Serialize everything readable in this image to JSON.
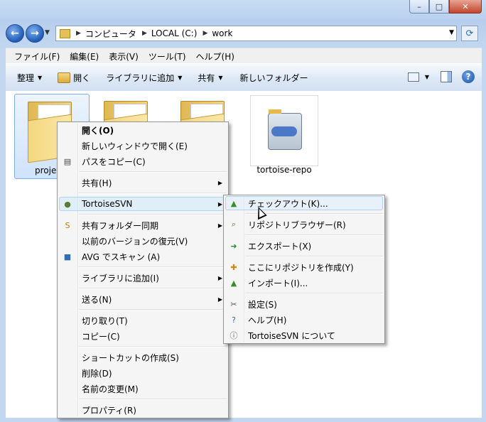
{
  "window": {
    "caption": {
      "min": "–",
      "max": "□",
      "close": "✕"
    }
  },
  "nav": {
    "back": "←",
    "forward": "→",
    "breadcrumb": [
      "コンピュータ",
      "LOCAL (C:)",
      "work"
    ]
  },
  "menubar": [
    "ファイル(F)",
    "編集(E)",
    "表示(V)",
    "ツール(T)",
    "ヘルプ(H)"
  ],
  "toolbar": {
    "organize": "整理",
    "open": "開く",
    "add_library": "ライブラリに追加",
    "share": "共有",
    "new_folder": "新しいフォルダー",
    "help": "?"
  },
  "files": [
    {
      "name": "proje"
    },
    {
      "name": ""
    },
    {
      "name": ""
    },
    {
      "name": "tortoise-repo"
    }
  ],
  "context_menu": [
    {
      "label": "開く(O)",
      "bold": true
    },
    {
      "label": "新しいウィンドウで開く(E)"
    },
    {
      "label": "パスをコピー(C)",
      "icon": "copy-path-icon"
    },
    {
      "sep": true
    },
    {
      "label": "共有(H)",
      "sub": true
    },
    {
      "sep": true
    },
    {
      "label": "TortoiseSVN",
      "sub": true,
      "icon": "tortoise-icon",
      "hl": true
    },
    {
      "sep": true
    },
    {
      "label": "共有フォルダー同期",
      "sub": true,
      "icon": "sync-icon"
    },
    {
      "label": "以前のバージョンの復元(V)"
    },
    {
      "label": "AVG でスキャン (A)",
      "icon": "avg-icon"
    },
    {
      "sep": true
    },
    {
      "label": "ライブラリに追加(I)",
      "sub": true
    },
    {
      "sep": true
    },
    {
      "label": "送る(N)",
      "sub": true
    },
    {
      "sep": true
    },
    {
      "label": "切り取り(T)"
    },
    {
      "label": "コピー(C)"
    },
    {
      "sep": true
    },
    {
      "label": "ショートカットの作成(S)"
    },
    {
      "label": "削除(D)"
    },
    {
      "label": "名前の変更(M)"
    },
    {
      "sep": true
    },
    {
      "label": "プロパティ(R)"
    }
  ],
  "svn_menu": [
    {
      "label": "チェックアウト(K)...",
      "icon": "checkout-icon",
      "hl": true
    },
    {
      "sep": true
    },
    {
      "label": "リポジトリブラウザー(R)",
      "icon": "repo-browser-icon"
    },
    {
      "sep": true
    },
    {
      "label": "エクスポート(X)",
      "icon": "export-icon"
    },
    {
      "sep": true
    },
    {
      "label": "ここにリポジトリを作成(Y)",
      "icon": "create-repo-icon"
    },
    {
      "label": "インポート(I)...",
      "icon": "import-icon"
    },
    {
      "sep": true
    },
    {
      "label": "設定(S)",
      "icon": "settings-icon"
    },
    {
      "label": "ヘルプ(H)",
      "icon": "help-icon"
    },
    {
      "label": "TortoiseSVN について",
      "icon": "about-icon"
    }
  ]
}
